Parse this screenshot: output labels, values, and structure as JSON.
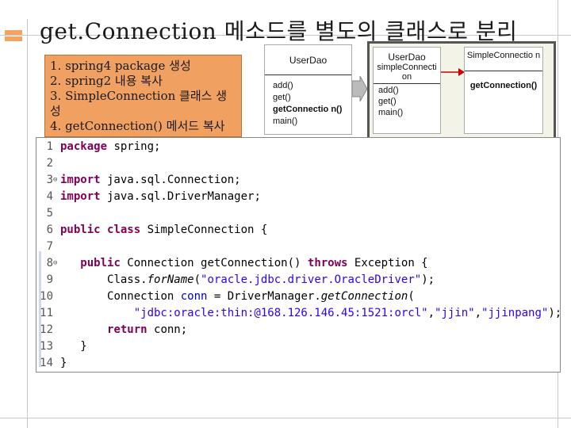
{
  "slide": {
    "title": "get.Connection 메소드를 별도의 클래스로 분리",
    "steps": [
      "1. spring4 package 생성",
      "2. spring2 내용 복사",
      "3. SimpleConnection 클래스 생성",
      "4. getConnection() 메서드 복사"
    ]
  },
  "diagram": {
    "dao_left": {
      "header": "UserDao",
      "members": [
        "add()",
        "get()",
        "getConnectio n()",
        "main()"
      ]
    },
    "dao_right": {
      "header": "UserDao",
      "field": "simpleConnecti on",
      "members": [
        "add()",
        "get()",
        "main()"
      ]
    },
    "simple_connection": {
      "header": "SimpleConnectio n",
      "members": [
        "getConnection()"
      ]
    },
    "colors": {
      "steps_bg": "#f0a060",
      "group_bg": "#f3f3e8",
      "arrow_red": "#cc0000"
    }
  },
  "code": {
    "line_numbers": [
      "1",
      "2",
      "3",
      "4",
      "5",
      "6",
      "7",
      "8",
      "9",
      "10",
      "11",
      "12",
      "13",
      "14"
    ],
    "folded_lines": [
      "3",
      "8"
    ],
    "l1_kw": "package",
    "l1_rest": " spring;",
    "l3_kw": "import",
    "l3_rest": " java.sql.Connection;",
    "l4_kw": "import",
    "l4_rest": " java.sql.DriverManager;",
    "l6_kw1": "public",
    "l6_kw2": "class",
    "l6_rest": " SimpleConnection {",
    "l8_kw1": "public",
    "l8_mid": " Connection getConnection() ",
    "l8_kw2": "throws",
    "l8_rest": " Exception {",
    "l9_a": "Class.",
    "l9_b": "forName",
    "l9_c": "(",
    "l9_str": "\"oracle.jdbc.driver.OracleDriver\"",
    "l9_d": ");",
    "l10_a": "Connection ",
    "l10_var": "conn",
    "l10_b": " = DriverManager.",
    "l10_c": "getConnection",
    "l10_d": "(",
    "l11_s1": "\"jdbc:oracle:thin:@168.126.146.45:1521:orcl\"",
    "l11_sep1": ",",
    "l11_s2": "\"jjin\"",
    "l11_sep2": ",",
    "l11_s3": "\"jjinpang\"",
    "l11_end": ");",
    "l12_kw": "return",
    "l12_var": " conn",
    "l12_end": ";",
    "l13": "}",
    "l14": "}"
  }
}
